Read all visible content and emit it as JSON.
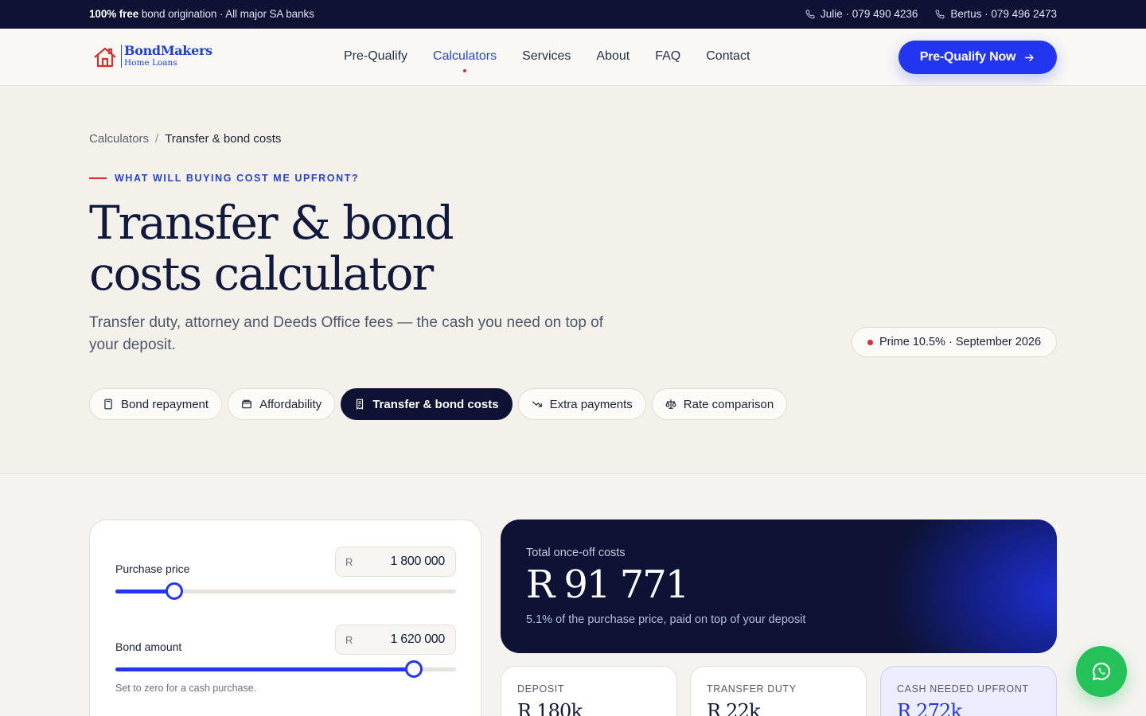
{
  "topbar": {
    "promo_bold": "100% free",
    "promo_rest": "bond origination · All major SA banks",
    "contacts": [
      "Julie · 079 490 4236",
      "Bertus · 079 496 2473"
    ]
  },
  "brand": {
    "name": "BondMakers",
    "tagline": "Home Loans"
  },
  "nav": {
    "items": [
      "Pre-Qualify",
      "Calculators",
      "Services",
      "About",
      "FAQ",
      "Contact"
    ],
    "active": "Calculators",
    "cta": "Pre-Qualify Now"
  },
  "hero": {
    "breadcrumb": [
      "Calculators",
      "Transfer & bond costs"
    ],
    "eyebrow": "WHAT WILL BUYING COST ME UPFRONT?",
    "title_line1": "Transfer & bond",
    "title_line2": "costs calculator",
    "subtitle": "Transfer duty, attorney and Deeds Office fees — the cash you need on top of your deposit.",
    "prime_badge": "Prime 10.5% · September 2026"
  },
  "tabs": [
    {
      "label": "Bond repayment",
      "icon": "calculator-icon"
    },
    {
      "label": "Affordability",
      "icon": "wallet-icon"
    },
    {
      "label": "Transfer & bond costs",
      "icon": "receipt-icon",
      "active": true
    },
    {
      "label": "Extra payments",
      "icon": "trend-down-icon"
    },
    {
      "label": "Rate comparison",
      "icon": "scale-icon"
    }
  ],
  "inputs": {
    "purchase_price": {
      "label": "Purchase price",
      "currency": "R",
      "value": "1 800 000",
      "slider_fraction": 0.173
    },
    "bond_amount": {
      "label": "Bond amount",
      "currency": "R",
      "value": "1 620 000",
      "slider_fraction": 0.875,
      "hint": "Set to zero for a cash purchase."
    }
  },
  "results": {
    "total_label": "Total once-off costs",
    "total_value": "R 91 771",
    "total_note": "5.1% of the purchase price, paid on top of your deposit",
    "stats": [
      {
        "label": "DEPOSIT",
        "value": "R 180k"
      },
      {
        "label": "TRANSFER DUTY",
        "value": "R 22k"
      },
      {
        "label": "CASH NEEDED UPFRONT",
        "value": "R 272k",
        "highlight": true
      }
    ]
  },
  "colors": {
    "navy": "#0e1336",
    "accent": "#2235f0",
    "red": "#d62f2f",
    "whatsapp": "#25c25a"
  }
}
